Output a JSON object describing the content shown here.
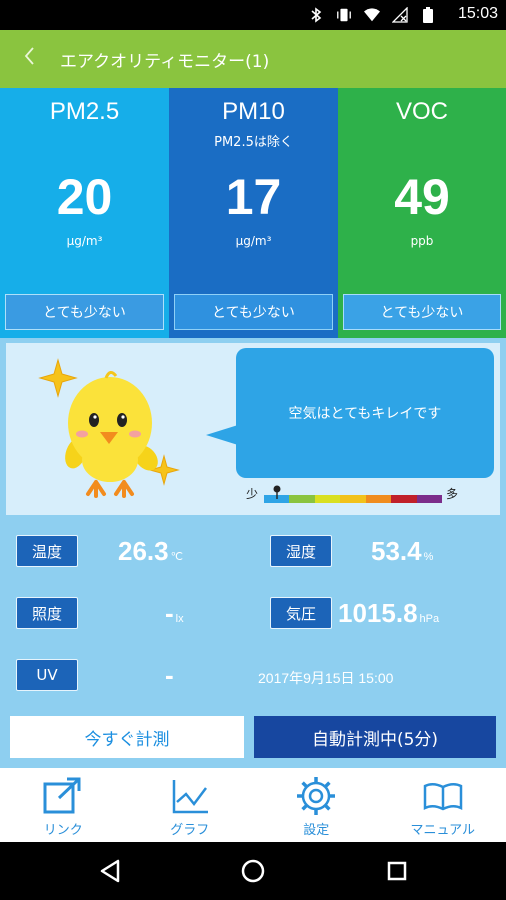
{
  "status_bar": {
    "time": "15:03",
    "icons": [
      "bluetooth-icon",
      "vibrate-icon",
      "wifi-icon",
      "no-signal-icon",
      "battery-icon"
    ]
  },
  "app_bar": {
    "back_icon": "chevron-left-icon",
    "title": "エアクオリティモニター(1)"
  },
  "metrics": [
    {
      "name": "PM2.5",
      "subtitle": "",
      "value": "20",
      "unit": "μg/m³",
      "level": "とても少ない",
      "color": "#16aee9"
    },
    {
      "name": "PM10",
      "subtitle": "PM2.5は除く",
      "value": "17",
      "unit": "μg/m³",
      "level": "とても少ない",
      "color": "#1a6dc4"
    },
    {
      "name": "VOC",
      "subtitle": "",
      "value": "49",
      "unit": "ppb",
      "level": "とても少ない",
      "color": "#2eb14a"
    }
  ],
  "character": {
    "message": "空気はとてもキレイです",
    "scale_low": "少",
    "scale_high": "多",
    "scale_colors": [
      "#2ea4e6",
      "#8ac43f",
      "#d9e021",
      "#f2c21b",
      "#f08c1e",
      "#c0202a",
      "#7b2d8b"
    ],
    "scale_level": 0.05
  },
  "readings": {
    "temperature": {
      "label": "温度",
      "value": "26.3",
      "unit": "℃"
    },
    "humidity": {
      "label": "湿度",
      "value": "53.4",
      "unit": "%"
    },
    "illuminance": {
      "label": "照度",
      "value": "-",
      "unit": "lx"
    },
    "pressure": {
      "label": "気圧",
      "value": "1015.8",
      "unit": "hPa"
    },
    "uv": {
      "label": "UV",
      "value": "-"
    },
    "timestamp": "2017年9月15日 15:00"
  },
  "actions": {
    "measure_now": "今すぐ計測",
    "auto_measure": "自動計測中(5分)"
  },
  "bottom_nav": [
    {
      "label": "リンク",
      "icon": "external-link-icon"
    },
    {
      "label": "グラフ",
      "icon": "line-graph-icon"
    },
    {
      "label": "設定",
      "icon": "gear-icon"
    },
    {
      "label": "マニュアル",
      "icon": "book-icon"
    }
  ],
  "system_nav": [
    "back-triangle-icon",
    "home-circle-icon",
    "recents-square-icon"
  ]
}
